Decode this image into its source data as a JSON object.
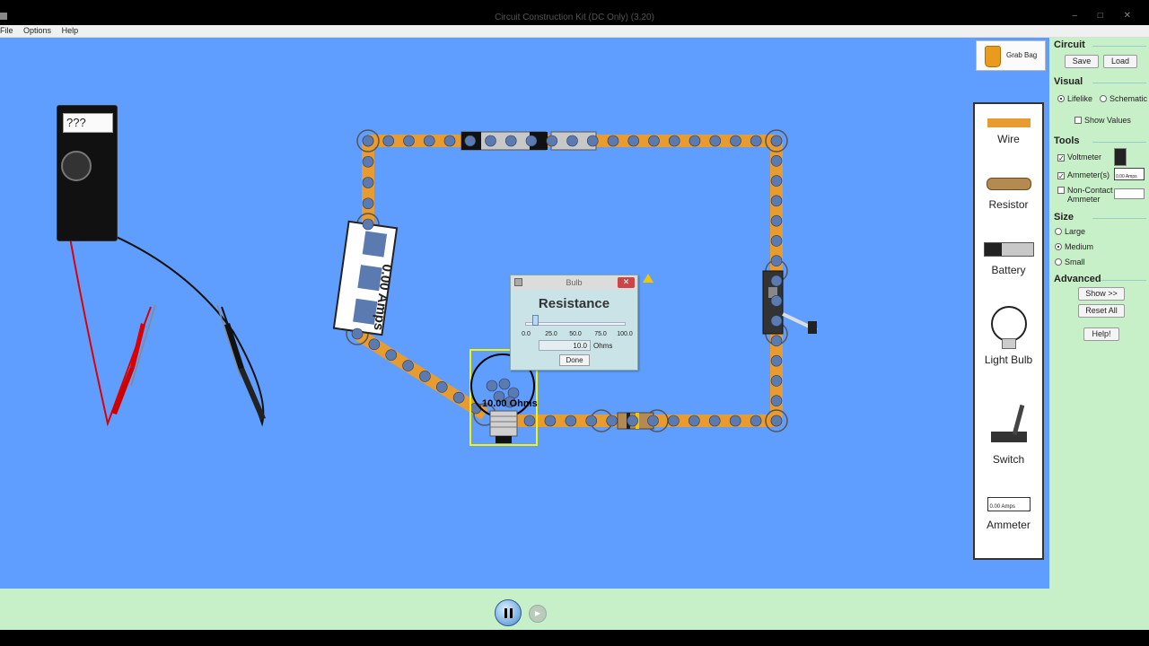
{
  "window": {
    "title": "Circuit Construction Kit (DC Only) (3.20)",
    "buttons": "–  □  ✕"
  },
  "menu": [
    "File",
    "Options",
    "Help"
  ],
  "grab_bag": {
    "label": "Grab Bag"
  },
  "toolbox": {
    "items": [
      {
        "label": "Wire",
        "icon": "wire-icon"
      },
      {
        "label": "Resistor",
        "icon": "resistor-icon"
      },
      {
        "label": "Battery",
        "icon": "battery-icon"
      },
      {
        "label": "Light Bulb",
        "icon": "light-bulb-icon"
      },
      {
        "label": "Switch",
        "icon": "switch-icon"
      },
      {
        "label": "Ammeter",
        "icon": "ammeter-icon"
      }
    ],
    "ammeter_icon_text": "0.00 Amps"
  },
  "panel": {
    "circuit": {
      "title": "Circuit",
      "save": "Save",
      "load": "Load"
    },
    "visual": {
      "title": "Visual",
      "lifelike": "Lifelike",
      "schematic": "Schematic",
      "show_values": "Show Values",
      "selected": "Lifelike"
    },
    "tools": {
      "title": "Tools",
      "voltmeter": "Voltmeter",
      "ammeters": "Ammeter(s)",
      "noncontact": "Non-Contact Ammeter",
      "noncontact_line1": "Non-Contact",
      "noncontact_line2": "Ammeter",
      "ammeter_thumb_text": "0.00 Amps"
    },
    "size": {
      "title": "Size",
      "large": "Large",
      "medium": "Medium",
      "small": "Small",
      "selected": "Medium"
    },
    "advanced": {
      "title": "Advanced",
      "show": "Show >>",
      "reset": "Reset All",
      "help": "Help!"
    }
  },
  "dialog": {
    "title": "Bulb",
    "heading": "Resistance",
    "ticks": [
      "0.0",
      "25.0",
      "50.0",
      "75.0",
      "100.0"
    ],
    "value": "10.0",
    "unit": "Ohms",
    "done": "Done",
    "close": "✕",
    "slider_value": 10.0,
    "slider_max": 100.0
  },
  "canvas": {
    "ammeter_reading": "0.00 Amps",
    "bulb_label": "10.00 Ohms",
    "meter_display": "???"
  },
  "colors": {
    "play_area": "#5f9eff",
    "panel": "#c8f0c8",
    "wire": "#e89b2e",
    "electron": "#5a7ab0",
    "selection": "#f5f500"
  }
}
